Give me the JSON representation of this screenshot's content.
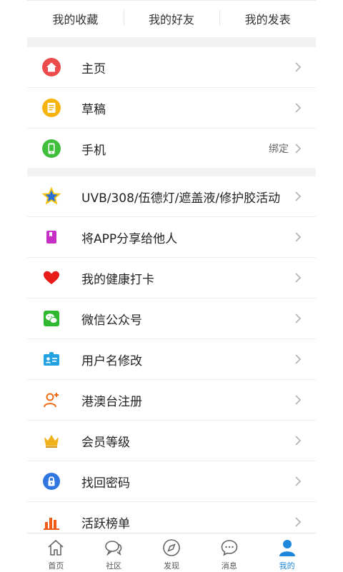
{
  "top_tabs": [
    "我的收藏",
    "我的好友",
    "我的发表"
  ],
  "group1": [
    {
      "label": "主页",
      "icon": "home-icon"
    },
    {
      "label": "草稿",
      "icon": "draft-icon"
    },
    {
      "label": "手机",
      "icon": "phone-icon",
      "extra": "绑定"
    }
  ],
  "group2": [
    {
      "label": "UVB/308/伍德灯/遮盖液/修护胶活动",
      "icon": "star-icon"
    },
    {
      "label": "将APP分享给他人",
      "icon": "share-book-icon"
    },
    {
      "label": "我的健康打卡",
      "icon": "heart-icon"
    },
    {
      "label": "微信公众号",
      "icon": "wechat-icon"
    },
    {
      "label": "用户名修改",
      "icon": "id-card-icon"
    },
    {
      "label": "港澳台注册",
      "icon": "add-user-icon"
    },
    {
      "label": "会员等级",
      "icon": "crown-icon"
    },
    {
      "label": "找回密码",
      "icon": "lock-icon"
    },
    {
      "label": "活跃榜单",
      "icon": "ranking-chart-icon"
    }
  ],
  "bottom_nav": [
    {
      "label": "首页",
      "icon": "home-outline-icon"
    },
    {
      "label": "社区",
      "icon": "community-icon"
    },
    {
      "label": "发现",
      "icon": "compass-icon"
    },
    {
      "label": "消息",
      "icon": "message-icon"
    },
    {
      "label": "我的",
      "icon": "user-icon",
      "active": true
    }
  ],
  "colors": {
    "active_tab": "#1d86dd",
    "home_red": "#ec4b4b",
    "draft_yellow": "#f6b40f",
    "phone_green": "#3fbf3a",
    "heart_red": "#e81b1b",
    "wechat_green": "#2fb82f",
    "lock_blue": "#2f76e0",
    "crown_gold": "#f0b31b",
    "chart_orange": "#f05a14"
  }
}
